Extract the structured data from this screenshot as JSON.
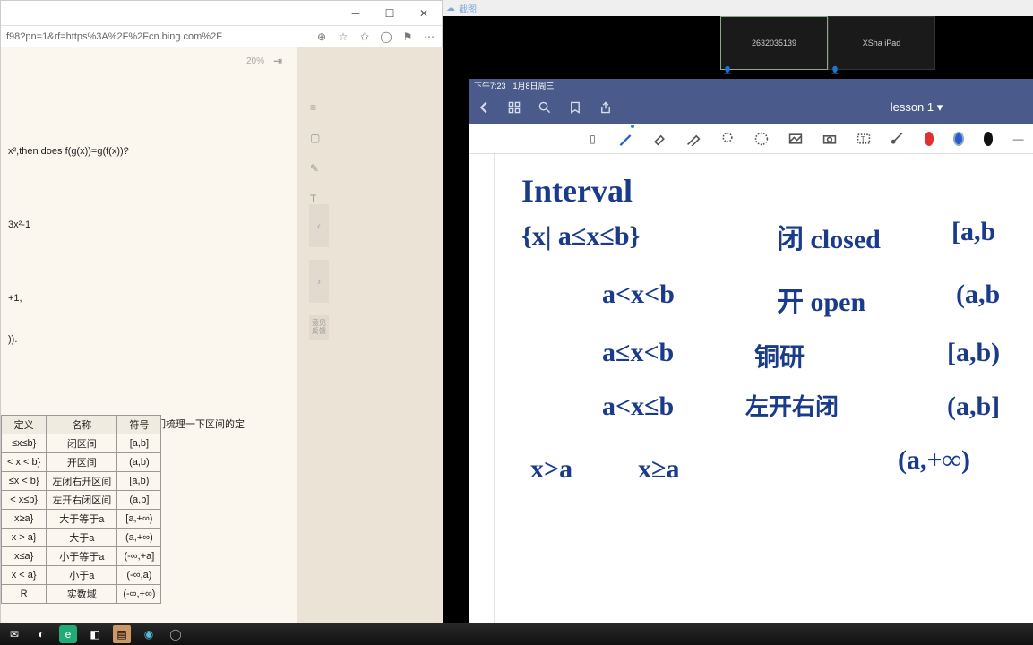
{
  "browser": {
    "url": "f98?pn=1&rf=https%3A%2F%2Fcn.bing.com%2F",
    "zoom": "20%",
    "lines": {
      "l1": "x²,then does f(g(x))=g(f(x))?",
      "l2": "3x²-1",
      "l3": "+1,",
      "l4": ")).",
      "l5": "值域的常用表示方法，这里帮同学们梳理一下区间的定"
    }
  },
  "table": {
    "h1": "定义",
    "h2": "名称",
    "h3": "符号",
    "rows": [
      {
        "d": "≤x≤b}",
        "n": "闭区间",
        "s": "[a,b]"
      },
      {
        "d": "< x < b}",
        "n": "开区间",
        "s": "(a,b)"
      },
      {
        "d": "≤x < b}",
        "n": "左闭右开区间",
        "s": "[a,b)"
      },
      {
        "d": "< x≤b}",
        "n": "左开右闭区间",
        "s": "(a,b]"
      },
      {
        "d": "x≥a}",
        "n": "大于等于a",
        "s": "[a,+∞)"
      },
      {
        "d": "x > a}",
        "n": "大于a",
        "s": "(a,+∞)"
      },
      {
        "d": "x≤a}",
        "n": "小于等于a",
        "s": "(-∞,+a]"
      },
      {
        "d": "x < a}",
        "n": "小于a",
        "s": "(-∞,a)"
      },
      {
        "d": "R",
        "n": "实数域",
        "s": "(-∞,+∞)"
      }
    ]
  },
  "remote": {
    "app_label": "截图",
    "tab1": "2632035139",
    "tab2": "XSha iPad"
  },
  "ipad": {
    "time": "下午7:23",
    "date": "1月8日周三",
    "title": "lesson 1",
    "feedback": "意见反馈"
  },
  "handwriting": {
    "t1": "Interval",
    "t2": "{x| a≤x≤b}",
    "t3": "闭 closed",
    "t4": "[a,b",
    "t5": "a<x<b",
    "t6": "开 open",
    "t7": "(a,b",
    "t8": "a≤x<b",
    "t9": "铜研",
    "t10": "[a,b)",
    "t11": "a<x≤b",
    "t12": "左开右闭",
    "t13": "(a,b]",
    "t14": "x>a",
    "t15": "x≥a",
    "t16": "(a,+∞)"
  },
  "colors": {
    "red": "#e03030",
    "blue": "#2a5ad0",
    "black": "#111"
  }
}
